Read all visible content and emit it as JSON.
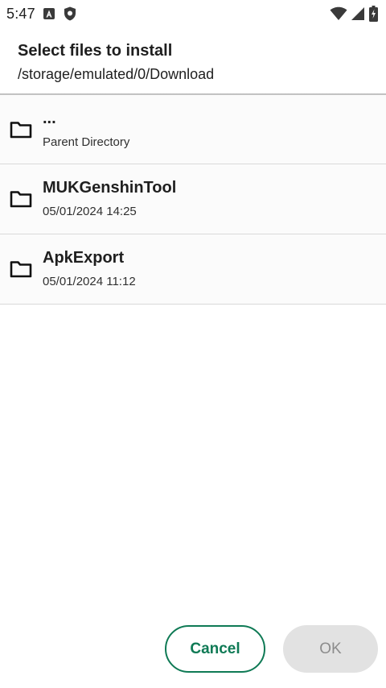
{
  "status_bar": {
    "time": "5:47",
    "left_icons": [
      "font-a-icon",
      "shield-icon"
    ],
    "right_icons": [
      "wifi-icon",
      "signal-icon",
      "battery-charging-icon"
    ]
  },
  "header": {
    "title": "Select files to install",
    "path": "/storage/emulated/0/Download"
  },
  "files": [
    {
      "icon": "folder-icon",
      "name": "...",
      "subtitle": "Parent Directory"
    },
    {
      "icon": "folder-icon",
      "name": "MUKGenshinTool",
      "subtitle": "05/01/2024 14:25"
    },
    {
      "icon": "folder-icon",
      "name": "ApkExport",
      "subtitle": "05/01/2024 11:12"
    }
  ],
  "actions": {
    "cancel_label": "Cancel",
    "ok_label": "OK",
    "ok_enabled": false,
    "accent_color": "#0f7a55"
  }
}
